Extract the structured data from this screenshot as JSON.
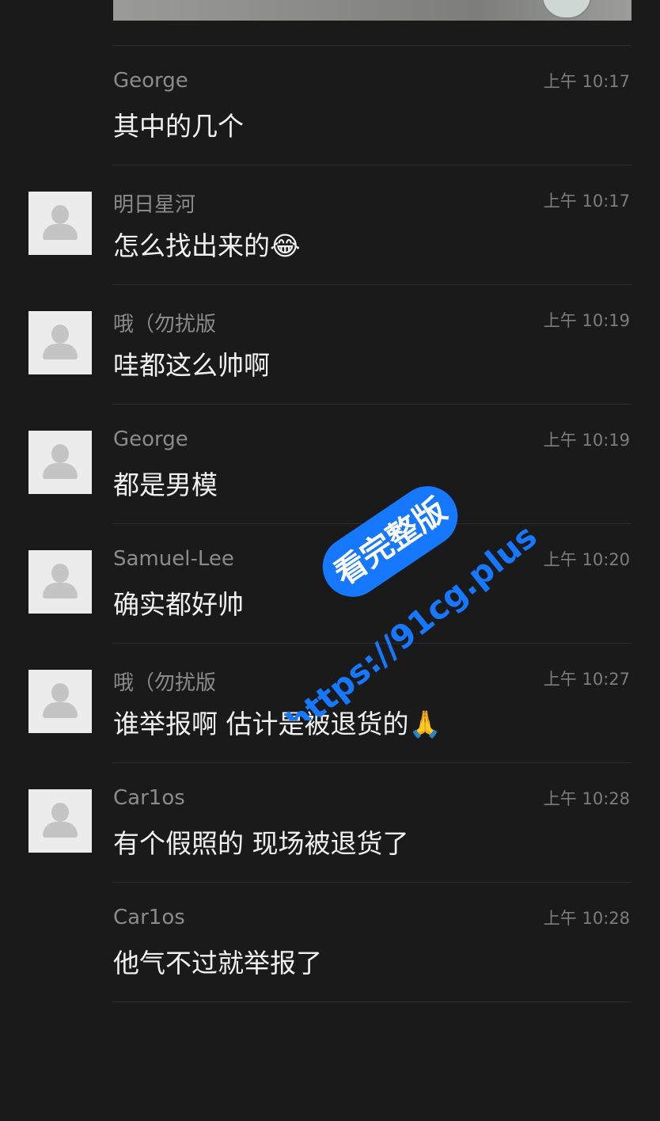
{
  "messages": [
    {
      "sender": "George",
      "time": "上午 10:17",
      "text": "其中的几个",
      "avatar": false
    },
    {
      "sender": "明日星河",
      "time": "上午 10:17",
      "text": "怎么找出来的😂",
      "avatar": true
    },
    {
      "sender": "哦（勿扰版",
      "time": "上午 10:19",
      "text": "哇都这么帅啊",
      "avatar": true
    },
    {
      "sender": "George",
      "time": "上午 10:19",
      "text": "都是男模",
      "avatar": true
    },
    {
      "sender": "Samuel-Lee",
      "time": "上午 10:20",
      "text": "确实都好帅",
      "avatar": true
    },
    {
      "sender": "哦（勿扰版",
      "time": "上午 10:27",
      "text": "谁举报啊 估计是被退货的🙏",
      "avatar": true
    },
    {
      "sender": "Car1os",
      "time": "上午 10:28",
      "text": "有个假照的 现场被退货了",
      "avatar": true
    },
    {
      "sender": "Car1os",
      "time": "上午 10:28",
      "text": "他气不过就举报了",
      "avatar": false
    }
  ],
  "watermark": {
    "badge_text": "看完整版",
    "url_text": "https://91cg.plus",
    "color": "#1677ff"
  },
  "colors": {
    "background": "#1a1a1b",
    "sender": "#8b8b8b",
    "time": "#7d7d7d",
    "message": "#f0f0f0"
  }
}
